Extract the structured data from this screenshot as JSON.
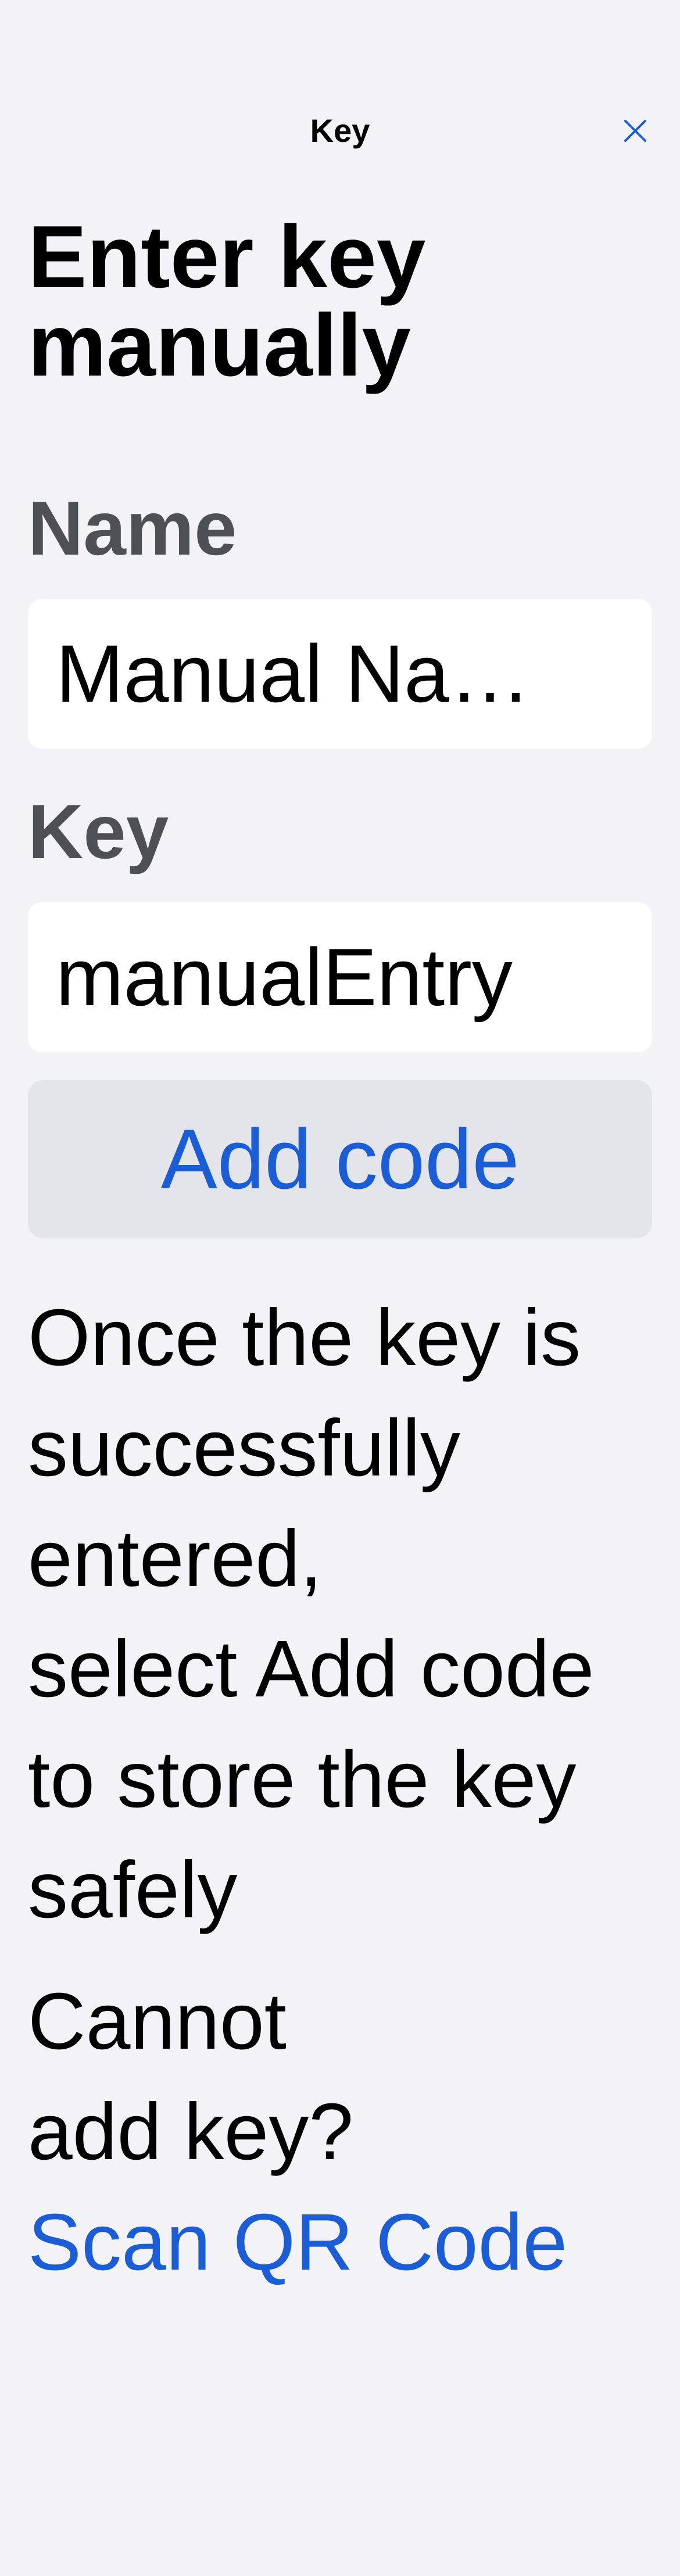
{
  "nav": {
    "title": "Key",
    "close_icon": "close-icon",
    "accent_color": "#1A5DD6"
  },
  "main": {
    "heading": "Enter key manually",
    "name_field": {
      "label": "Name",
      "value": "Manual Na…"
    },
    "key_field": {
      "label": "Key",
      "value": "manualEntry"
    },
    "add_button_label": "Add code",
    "instructions": "Once the key is\nsuccessfully\nentered,\nselect Add code\nto store the key\nsafely",
    "cannot_text": "Cannot\nadd key?",
    "scan_link_label": "Scan QR Code"
  }
}
